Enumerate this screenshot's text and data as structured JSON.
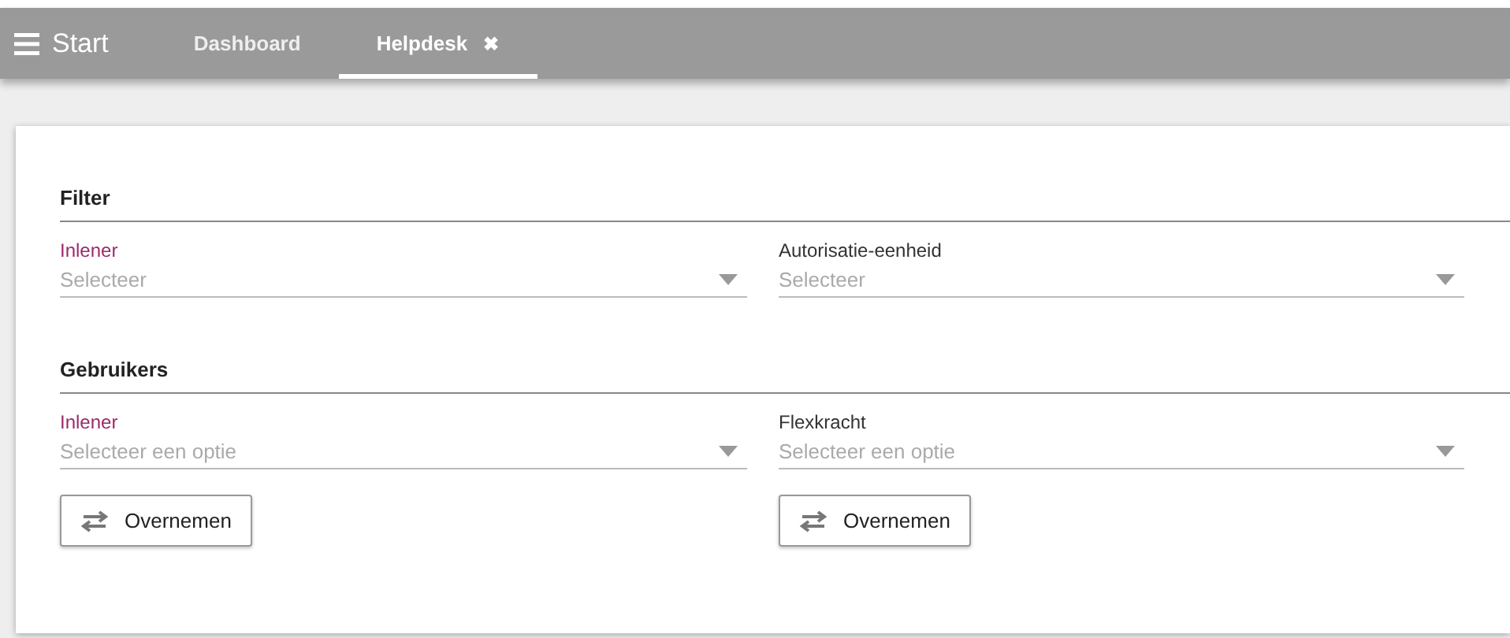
{
  "header": {
    "title": "Start",
    "tabs": [
      {
        "label": "Dashboard",
        "selected": false
      },
      {
        "label": "Helpdesk",
        "selected": true,
        "close_icon": "✖"
      }
    ]
  },
  "sections": [
    {
      "title": "Filter",
      "fields": [
        {
          "label": "Inlener",
          "placeholder": "Selecteer",
          "required": true
        },
        {
          "label": "Autorisatie-eenheid",
          "placeholder": "Selecteer",
          "required": false
        }
      ]
    },
    {
      "title": "Gebruikers",
      "fields": [
        {
          "label": "Inlener",
          "placeholder": "Selecteer een optie",
          "required": true
        },
        {
          "label": "Flexkracht",
          "placeholder": "Selecteer een optie",
          "required": false
        }
      ],
      "buttons": [
        "Overnemen",
        "Overnemen"
      ]
    }
  ]
}
